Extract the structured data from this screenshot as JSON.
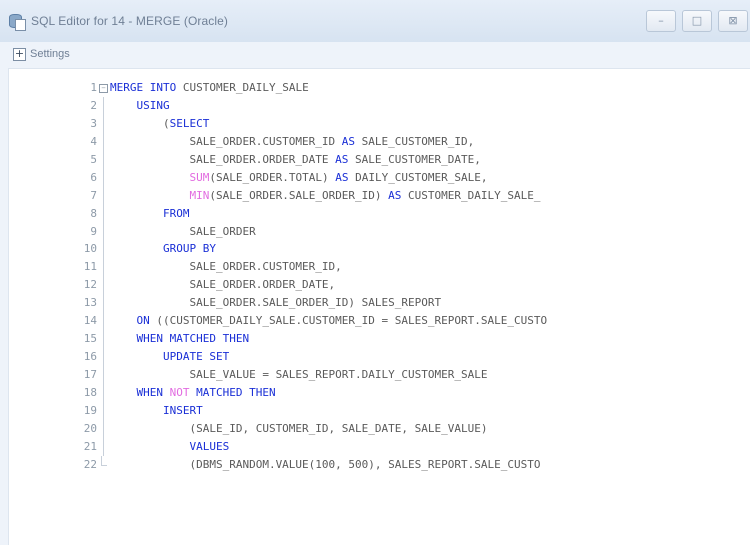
{
  "window": {
    "title": "SQL Editor for 14 - MERGE (Oracle)",
    "controls": {
      "minimize": "–",
      "maximize": "□",
      "close": "⊠"
    }
  },
  "toolbar": {
    "expander": "+",
    "settings_label": "Settings"
  },
  "colors": {
    "keyword": "#1a2fd6",
    "function": "#e26be0",
    "text": "#5a5a5a",
    "line_number": "#8d9aa8"
  },
  "editor": {
    "lines": [
      {
        "n": "1",
        "fold": "box",
        "segments": [
          [
            "MERGE INTO",
            "kw"
          ],
          [
            " CUSTOMER_DAILY_SALE",
            "txt"
          ]
        ]
      },
      {
        "n": "2",
        "fold": "line",
        "segments": [
          [
            "    USING",
            "kw"
          ]
        ]
      },
      {
        "n": "3",
        "fold": "line",
        "segments": [
          [
            "        (",
            "txt"
          ],
          [
            "SELECT",
            "kw"
          ]
        ]
      },
      {
        "n": "4",
        "fold": "line",
        "segments": [
          [
            "            SALE_ORDER.CUSTOMER_ID ",
            "txt"
          ],
          [
            "AS",
            "kw"
          ],
          [
            " SALE_CUSTOMER_ID,",
            "txt"
          ]
        ]
      },
      {
        "n": "5",
        "fold": "line",
        "segments": [
          [
            "            SALE_ORDER.ORDER_DATE ",
            "txt"
          ],
          [
            "AS",
            "kw"
          ],
          [
            " SALE_CUSTOMER_DATE,",
            "txt"
          ]
        ]
      },
      {
        "n": "6",
        "fold": "line",
        "segments": [
          [
            "            ",
            "txt"
          ],
          [
            "SUM",
            "fn"
          ],
          [
            "(SALE_ORDER.TOTAL) ",
            "txt"
          ],
          [
            "AS",
            "kw"
          ],
          [
            " DAILY_CUSTOMER_SALE,",
            "txt"
          ]
        ]
      },
      {
        "n": "7",
        "fold": "line",
        "segments": [
          [
            "            ",
            "txt"
          ],
          [
            "MIN",
            "fn"
          ],
          [
            "(SALE_ORDER.SALE_ORDER_ID) ",
            "txt"
          ],
          [
            "AS",
            "kw"
          ],
          [
            " CUSTOMER_DAILY_SALE_",
            "txt"
          ]
        ]
      },
      {
        "n": "8",
        "fold": "line",
        "segments": [
          [
            "        ",
            "txt"
          ],
          [
            "FROM",
            "kw"
          ]
        ]
      },
      {
        "n": "9",
        "fold": "line",
        "segments": [
          [
            "            SALE_ORDER",
            "txt"
          ]
        ]
      },
      {
        "n": "10",
        "fold": "line",
        "segments": [
          [
            "        ",
            "txt"
          ],
          [
            "GROUP BY",
            "kw"
          ]
        ]
      },
      {
        "n": "11",
        "fold": "line",
        "segments": [
          [
            "            SALE_ORDER.CUSTOMER_ID,",
            "txt"
          ]
        ]
      },
      {
        "n": "12",
        "fold": "line",
        "segments": [
          [
            "            SALE_ORDER.ORDER_DATE,",
            "txt"
          ]
        ]
      },
      {
        "n": "13",
        "fold": "line",
        "segments": [
          [
            "            SALE_ORDER.SALE_ORDER_ID) SALES_REPORT",
            "txt"
          ]
        ]
      },
      {
        "n": "14",
        "fold": "line",
        "segments": [
          [
            "    ",
            "txt"
          ],
          [
            "ON",
            "kw"
          ],
          [
            " ((CUSTOMER_DAILY_SALE.CUSTOMER_ID = SALES_REPORT.SALE_CUSTO",
            "txt"
          ]
        ]
      },
      {
        "n": "15",
        "fold": "line",
        "segments": [
          [
            "    ",
            "txt"
          ],
          [
            "WHEN MATCHED THEN",
            "kw"
          ]
        ]
      },
      {
        "n": "16",
        "fold": "line",
        "segments": [
          [
            "        ",
            "txt"
          ],
          [
            "UPDATE SET",
            "kw"
          ]
        ]
      },
      {
        "n": "17",
        "fold": "line",
        "segments": [
          [
            "            SALE_VALUE = SALES_REPORT.DAILY_CUSTOMER_SALE",
            "txt"
          ]
        ]
      },
      {
        "n": "18",
        "fold": "line",
        "segments": [
          [
            "    ",
            "txt"
          ],
          [
            "WHEN ",
            "kw"
          ],
          [
            "NOT",
            "fn"
          ],
          [
            " MATCHED THEN",
            "kw"
          ]
        ]
      },
      {
        "n": "19",
        "fold": "line",
        "segments": [
          [
            "        ",
            "txt"
          ],
          [
            "INSERT",
            "kw"
          ]
        ]
      },
      {
        "n": "20",
        "fold": "line",
        "segments": [
          [
            "            (SALE_ID, CUSTOMER_ID, SALE_DATE, SALE_VALUE)",
            "txt"
          ]
        ]
      },
      {
        "n": "21",
        "fold": "line",
        "segments": [
          [
            "            ",
            "txt"
          ],
          [
            "VALUES",
            "kw"
          ]
        ]
      },
      {
        "n": "22",
        "fold": "end",
        "segments": [
          [
            "            (DBMS_RANDOM.VALUE(100, 500), SALES_REPORT.SALE_CUSTO",
            "txt"
          ]
        ]
      }
    ]
  }
}
